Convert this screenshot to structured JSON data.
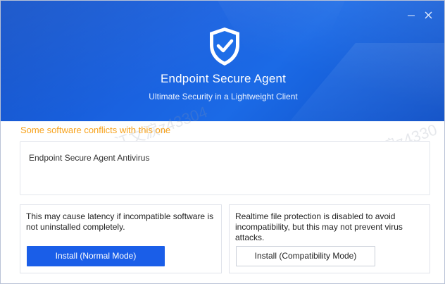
{
  "window": {
    "title": "Endpoint Secure Agent",
    "subtitle": "Ultimate Security in a Lightweight Client",
    "controls": {
      "minimize_icon": "minimize-icon",
      "close_icon": "close-icon"
    },
    "accent_color": "#1a5ee8",
    "header_color": "#1b63e0"
  },
  "logo": {
    "icon": "shield-check-icon"
  },
  "watermark": {
    "text_left": "江文涙z43304",
    "text_right": "江文涙z4330"
  },
  "conflict": {
    "warning": "Some software conflicts with this one",
    "warning_color": "#f7a21b",
    "items": [
      "Endpoint Secure Agent Antivirus"
    ]
  },
  "options": [
    {
      "description": "This may cause latency if incompatible software is not uninstalled completely.",
      "button_label": "Install (Normal Mode)"
    },
    {
      "description": "Realtime file protection is disabled to avoid incompatibility, but this may not prevent virus attacks.",
      "button_label": "Install (Compatibility Mode)"
    }
  ]
}
